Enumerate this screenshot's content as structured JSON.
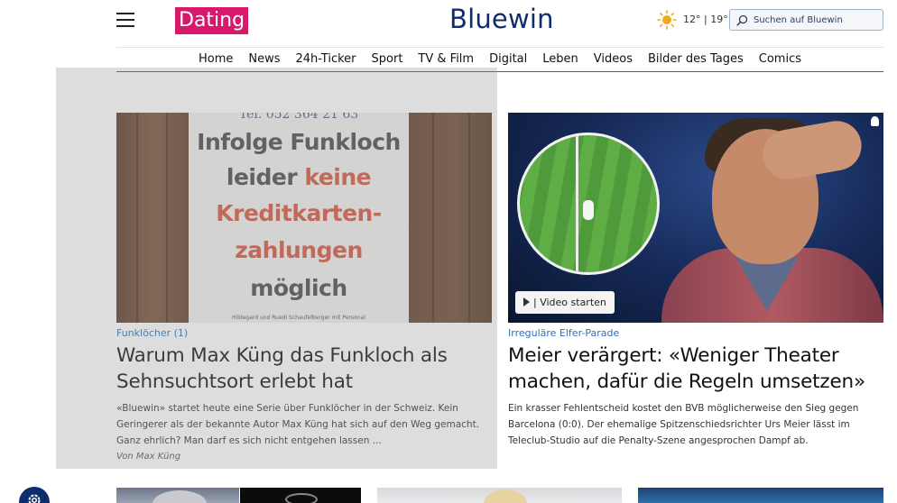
{
  "header": {
    "menu_icon": "hamburger-icon",
    "dating_label": "Dating",
    "logo_text": "Bluewin",
    "weather_icon": "sun-icon",
    "weather_text": "12° | 19°",
    "search_placeholder": "Suchen auf Bluewin",
    "search_icon": "search-icon"
  },
  "nav": {
    "items": [
      "Home",
      "News",
      "24h-Ticker",
      "Sport",
      "TV & Film",
      "Digital",
      "Leben",
      "Videos",
      "Bilder des Tages",
      "Comics"
    ]
  },
  "articles": [
    {
      "kicker": "Funklöcher (1)",
      "headline": "Warum Max Küng das Funkloch als Sehnsuchtsort erlebt hat",
      "teaser": "«Bluewin» startet heute eine Serie über Funklöcher in der Schweiz. Kein Geringerer als der bekannte Autor Max Küng hat sich auf den Weg gemacht. Ganz ehrlich? Man darf es sich nicht entgehen lassen ...",
      "author": "Von Max Küng",
      "image": {
        "phone": "Tel. 052 364 21 63",
        "lines": [
          "Infolge Funkloch",
          "leider",
          "keine",
          "Kreditkarten-",
          "zahlungen",
          "möglich"
        ],
        "footer": "Hildegard und Ruedi Schaufelberger mit Personal"
      }
    },
    {
      "kicker": "Irreguläre Elfer-Parade",
      "headline": "Meier verärgert: «Weniger Theater machen, dafür die Regeln umsetzen»",
      "teaser": "Ein krasser Fehlentscheid kostet den BVB möglicherweise den Sieg gegen Barcelona (0:0). Der ehemalige Spitzenschiedsrichter Urs Meier lässt im Teleclub-Studio auf die Penalty-Szene angesprochen Dampf ab.",
      "video_button": "| Video starten",
      "video_icon": "play-icon"
    }
  ],
  "settings_icon": "gear-icon",
  "colors": {
    "brand": "#102d6b",
    "dating": "#d6196b",
    "kicker": "#2b73b8"
  }
}
